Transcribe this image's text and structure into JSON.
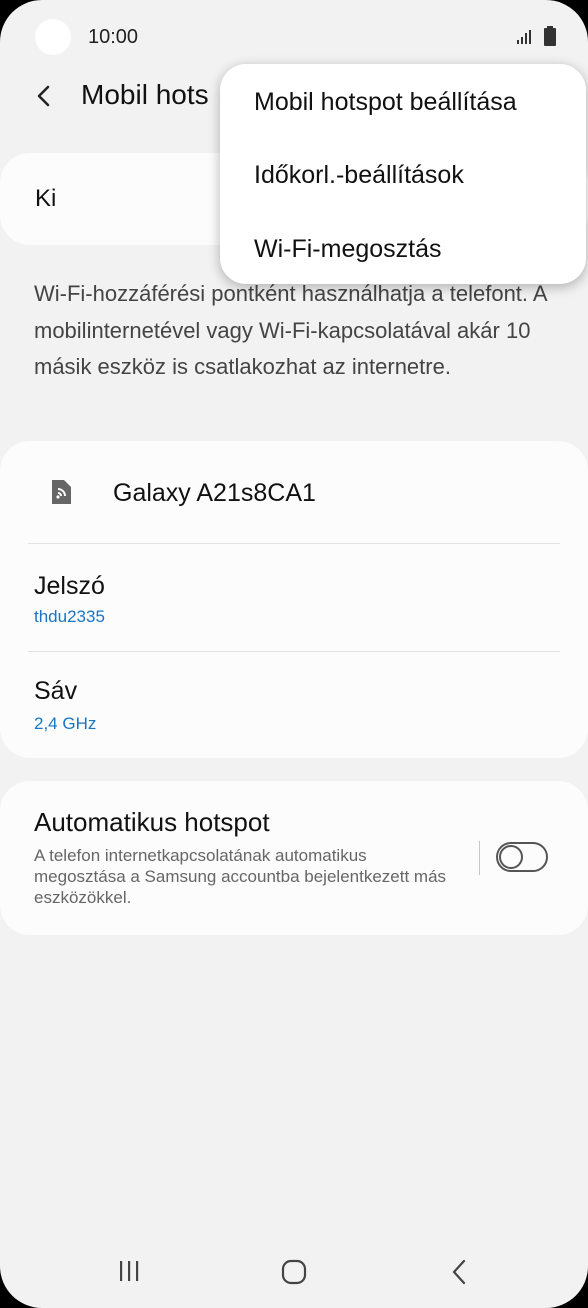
{
  "status_bar": {
    "time": "10:00"
  },
  "header": {
    "title": "Mobil hots"
  },
  "master_switch": {
    "label": "Ki"
  },
  "description": "Wi-Fi-hozzáférési pontként használhatja a telefont. A mobilinternetével vagy Wi-Fi-kapcsolatával akár 10 másik eszköz is csatlakozhat az internetre.",
  "network": {
    "name": "Galaxy A21s8CA1",
    "password_title": "Jelszó",
    "password_value": "thdu2335",
    "band_title": "Sáv",
    "band_value": "2,4 GHz"
  },
  "auto_hotspot": {
    "title": "Automatikus hotspot",
    "description": "A telefon internetkapcsolatának automatikus megosztása a Samsung accountba bejelentkezett más eszközökkel.",
    "enabled": false
  },
  "overflow_menu": {
    "items": [
      {
        "label": "Mobil hotspot beállítása"
      },
      {
        "label": "Időkorl.-beállítások"
      },
      {
        "label": "Wi-Fi-megosztás"
      }
    ]
  },
  "colors": {
    "background": "#f2f2f2",
    "card": "#fcfcfc",
    "accent_text": "#1a74c4"
  },
  "icons": {
    "back": "chevron-left-icon",
    "hotspot": "hotspot-device-icon",
    "nav_recents": "recents-icon",
    "nav_home": "home-icon",
    "nav_back": "back-icon"
  }
}
